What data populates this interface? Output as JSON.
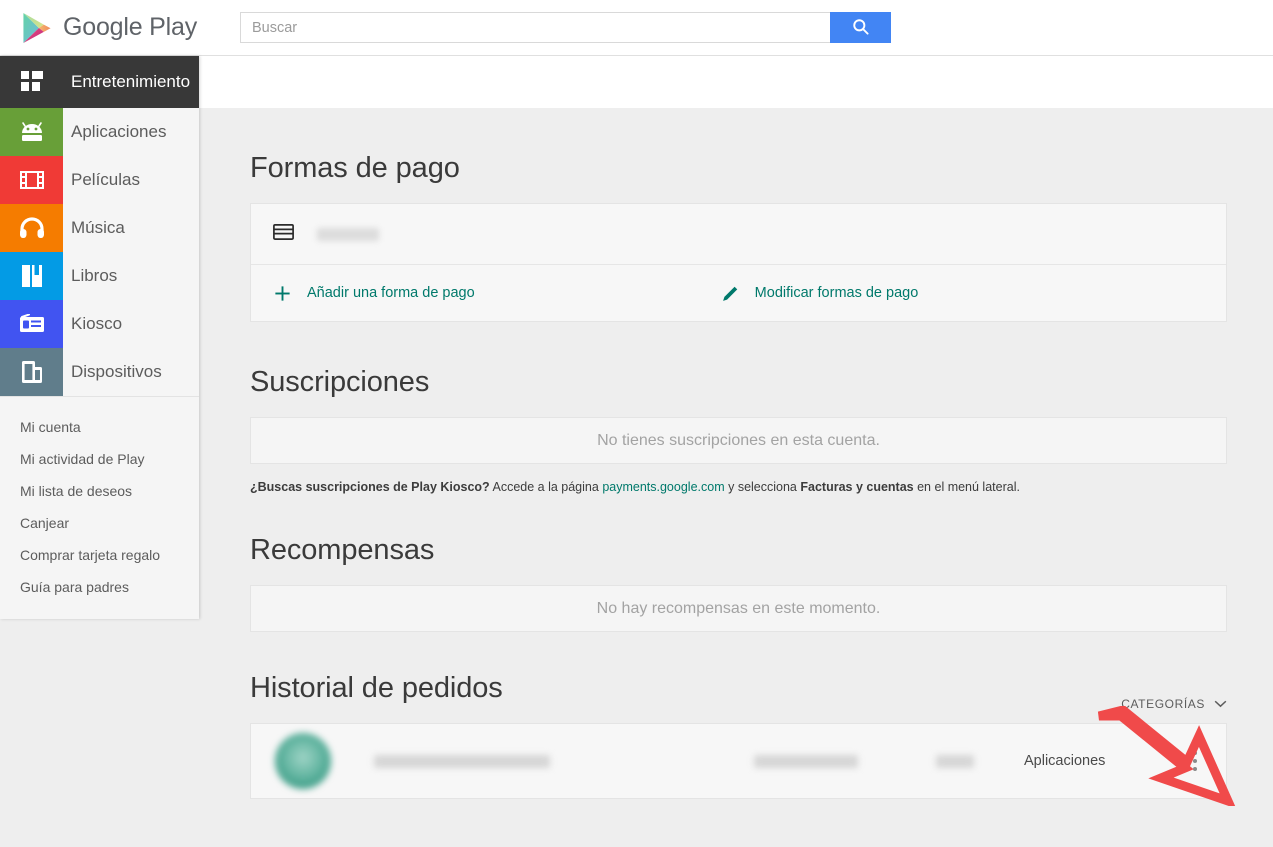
{
  "topbar": {
    "brand": "Google Play",
    "logo_icon": "google-play-triangle-logo",
    "search_placeholder": "Buscar",
    "search_value": "",
    "search_icon": "search-icon",
    "search_button_color": "#4285f4"
  },
  "sidebar": {
    "header": {
      "label": "Entretenimiento",
      "icon": "grid-apps-icon",
      "bg": "#383838"
    },
    "items": [
      {
        "label": "Aplicaciones",
        "icon": "android-robot-icon",
        "color": "#689f38"
      },
      {
        "label": "Películas",
        "icon": "film-strip-icon",
        "color": "#f03a36"
      },
      {
        "label": "Música",
        "icon": "headphones-icon",
        "color": "#f57c00"
      },
      {
        "label": "Libros",
        "icon": "open-book-icon",
        "color": "#039be5"
      },
      {
        "label": "Kiosco",
        "icon": "newsstand-icon",
        "color": "#4154f1"
      },
      {
        "label": "Dispositivos",
        "icon": "devices-icon",
        "color": "#607d8b"
      }
    ],
    "links": [
      "Mi cuenta",
      "Mi actividad de Play",
      "Mi lista de deseos",
      "Canjear",
      "Comprar tarjeta regalo",
      "Guía para padres"
    ]
  },
  "payment_methods": {
    "title": "Formas de pago",
    "card_icon": "credit-card-icon",
    "card_label_redacted": "",
    "add_label": "Añadir una forma de pago",
    "add_icon": "plus-icon",
    "edit_label": "Modificar formas de pago",
    "edit_icon": "pencil-icon",
    "link_color": "#00796b"
  },
  "subscriptions": {
    "title": "Suscripciones",
    "empty_message": "No tienes suscripciones en esta cuenta.",
    "footnote": {
      "lead": "¿Buscas suscripciones de Play Kiosco?",
      "mid1": "Accede a la página",
      "link": "payments.google.com",
      "mid2": "y selecciona",
      "bold2": "Facturas y cuentas",
      "tail": "en el menú lateral."
    }
  },
  "rewards": {
    "title": "Recompensas",
    "empty_message": "No hay recompensas en este momento."
  },
  "order_history": {
    "title": "Historial de pedidos",
    "categories_label": "CATEGORÍAS",
    "categories_icon": "chevron-down-icon",
    "rows": [
      {
        "app_icon": "app-icon-redacted",
        "name_redacted": "",
        "date_redacted": "",
        "price_redacted": "",
        "category": "Aplicaciones",
        "menu_icon": "three-dots-vertical-icon"
      }
    ]
  },
  "annotation": {
    "arrow_icon": "red-arrow-pointing-down-right",
    "color": "#f04a4a"
  }
}
